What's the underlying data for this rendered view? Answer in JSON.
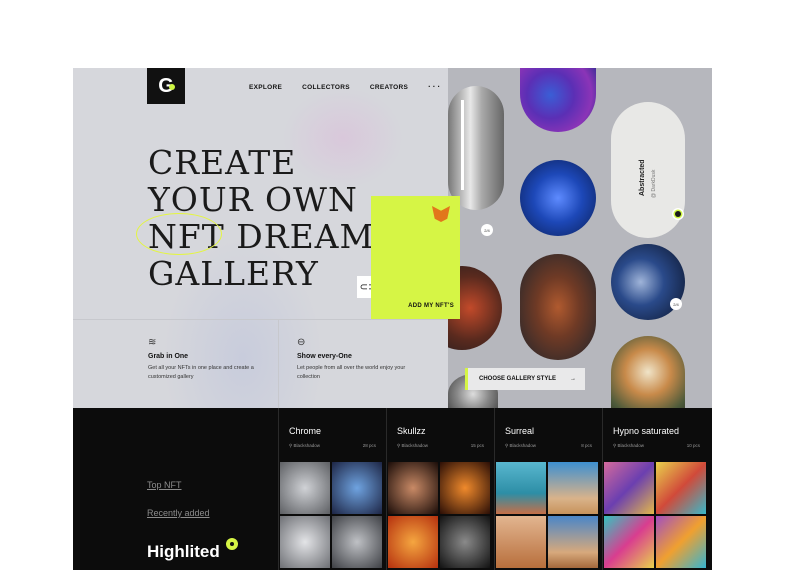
{
  "header": {
    "logo": "G",
    "nav": [
      "EXPLORE",
      "COLLECTORS",
      "CREATORS"
    ],
    "more": "···"
  },
  "hero": {
    "lines": [
      "CREATE",
      "YOUR OWN",
      "NFT DREAM",
      "GALLERY"
    ],
    "cta_label": "ADD MY NFT'S",
    "link_icon": "⊂⊃"
  },
  "features": [
    {
      "icon": "layers-icon",
      "title": "Grab in One",
      "desc": "Get all your NFTs in one place and create a customized gallery"
    },
    {
      "icon": "planet-icon",
      "title": "Show every-One",
      "desc": "Let people from all over the world enjoy your collection"
    }
  ],
  "gallery": {
    "card_title": "Abstracted",
    "card_sub": "@ DarkDusk",
    "badge1": "2/4",
    "badge2": "2/4",
    "choose_label": "CHOOSE GALLERY STYLE",
    "choose_arrow": "→"
  },
  "sidebar": {
    "links": [
      "Top NFT",
      "Recently added"
    ],
    "active": "Highlited"
  },
  "collections": [
    {
      "name": "Chrome",
      "author": "Blackshadow",
      "count": "28 pcs",
      "colors": [
        "#8d8f94",
        "#2f3d70",
        "#b9bbbe",
        "#5d5f63"
      ]
    },
    {
      "name": "Skullzz",
      "author": "Blackshadow",
      "count": "15 pcs",
      "colors": [
        "#3a1c14",
        "#a63b14",
        "#e36a1c",
        "#6b4c3a"
      ]
    },
    {
      "name": "Surreal",
      "author": "Blackshadow",
      "count": "8 pcs",
      "colors": [
        "#2d8ea6",
        "#cf7e46",
        "#d19a6c",
        "#3a6fb8"
      ]
    },
    {
      "name": "Hypno saturated",
      "author": "Blackshadow",
      "count": "10 pcs",
      "colors": [
        "#7a4ab3",
        "#d9a030",
        "#37c4c0",
        "#d93d8f"
      ]
    }
  ]
}
